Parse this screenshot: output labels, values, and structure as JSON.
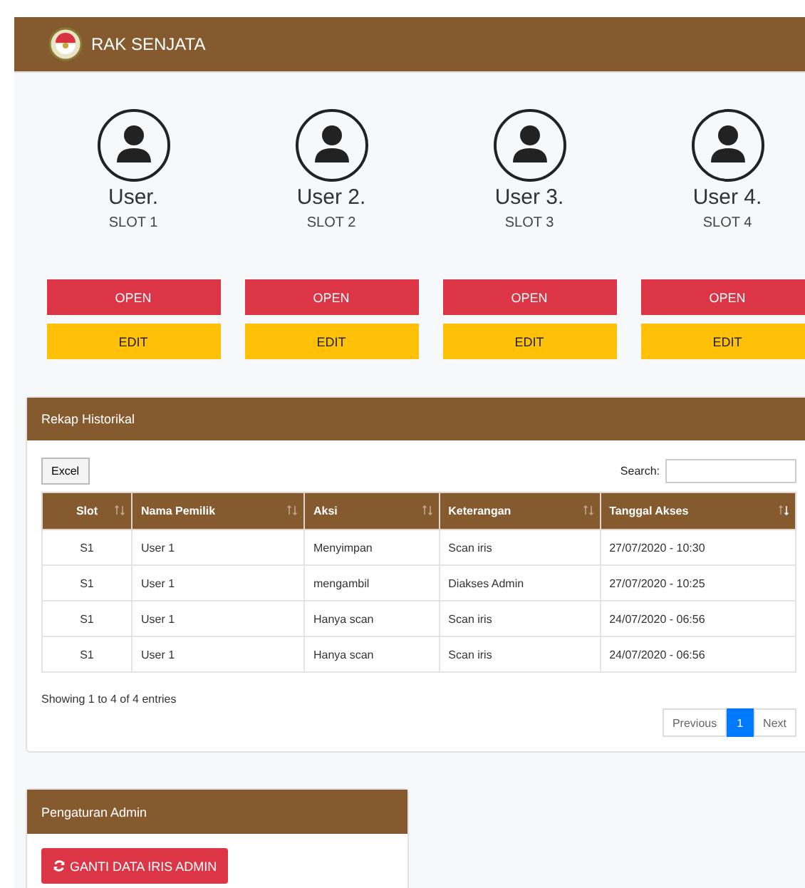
{
  "navbar": {
    "title": "RAK SENJATA"
  },
  "slots": [
    {
      "user": "User.",
      "slot": "SLOT 1",
      "open": "OPEN",
      "edit": "EDIT"
    },
    {
      "user": "User 2.",
      "slot": "SLOT 2",
      "open": "OPEN",
      "edit": "EDIT"
    },
    {
      "user": "User 3.",
      "slot": "SLOT 3",
      "open": "OPEN",
      "edit": "EDIT"
    },
    {
      "user": "User 4.",
      "slot": "SLOT 4",
      "open": "OPEN",
      "edit": "EDIT"
    }
  ],
  "history": {
    "title": "Rekap Historikal",
    "export_button": "Excel",
    "search_label": "Search:",
    "table": {
      "columns": [
        {
          "label": "Slot",
          "sorted": false
        },
        {
          "label": "Nama Pemilik",
          "sorted": false
        },
        {
          "label": "Aksi",
          "sorted": false
        },
        {
          "label": "Keterangan",
          "sorted": false
        },
        {
          "label": "Tanggal Akses",
          "sorted": true
        }
      ],
      "rows": [
        [
          "S1",
          "User 1",
          "Menyimpan",
          "Scan iris",
          "27/07/2020 - 10:30"
        ],
        [
          "S1",
          "User 1",
          "mengambil",
          "Diakses Admin",
          "27/07/2020 - 10:25"
        ],
        [
          "S1",
          "User 1",
          "Hanya scan",
          "Scan iris",
          "24/07/2020 - 06:56"
        ],
        [
          "S1",
          "User 1",
          "Hanya scan",
          "Scan iris",
          "24/07/2020 - 06:56"
        ]
      ]
    },
    "info": "Showing 1 to 4 of 4 entries",
    "pagination": [
      {
        "label": "Previous",
        "selected": false
      },
      {
        "label": "1",
        "selected": true
      },
      {
        "label": "Next",
        "selected": false
      }
    ]
  },
  "admin": {
    "title": "Pengaturan Admin",
    "button": "GANTI DATA IRIS ADMIN"
  }
}
